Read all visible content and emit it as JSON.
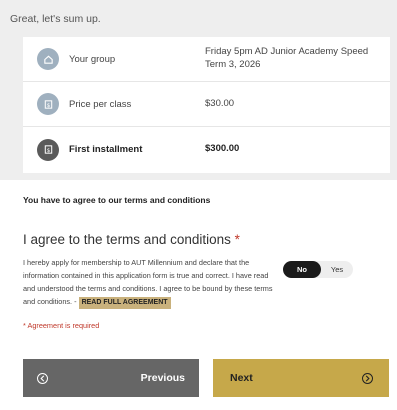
{
  "summary": {
    "heading": "Great, let's sum up.",
    "rows": [
      {
        "icon": "home-icon",
        "label": "Your group",
        "value": "Friday 5pm AD Junior Academy Speed Term 3, 2026"
      },
      {
        "icon": "dollar-icon",
        "label": "Price per class",
        "value": "$30.00"
      },
      {
        "icon": "dollar-icon",
        "label": "First installment",
        "value": "$300.00"
      }
    ]
  },
  "terms": {
    "note": "You have to agree to our terms and conditions",
    "heading": "I agree to the terms and conditions",
    "required_mark": "*",
    "body": "I hereby apply for membership to AUT Millennium and declare that the information contained in this application form is true and correct. I have read and understood the terms and conditions. I agree to be bound by these terms and conditions. -",
    "read_full_label": "READ FULL AGREEMENT",
    "toggle": {
      "no_label": "No",
      "yes_label": "Yes",
      "selected": "No"
    },
    "error": "* Agreement is required"
  },
  "nav": {
    "previous_label": "Previous",
    "next_label": "Next"
  },
  "colors": {
    "accent_gold": "#c6a84a",
    "badge_gold": "#c9b17c",
    "error_red": "#c0392b",
    "dark_gray": "#666666"
  }
}
